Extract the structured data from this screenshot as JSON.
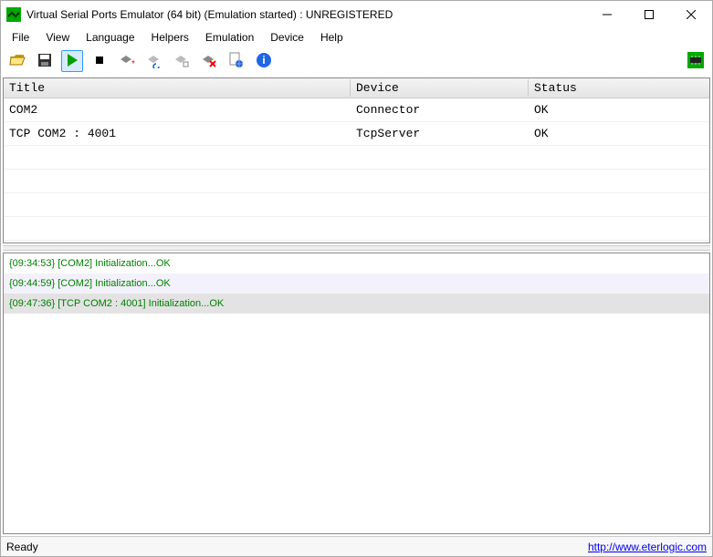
{
  "window": {
    "title": "Virtual Serial Ports Emulator (64 bit) (Emulation started) : UNREGISTERED"
  },
  "menu": {
    "items": [
      "File",
      "View",
      "Language",
      "Helpers",
      "Emulation",
      "Device",
      "Help"
    ]
  },
  "table": {
    "headers": {
      "title": "Title",
      "device": "Device",
      "status": "Status"
    },
    "rows": [
      {
        "title": "COM2",
        "device": "Connector",
        "status": "OK"
      },
      {
        "title": "TCP COM2 : 4001",
        "device": "TcpServer",
        "status": "OK"
      }
    ]
  },
  "log": {
    "entries": [
      "{09:34:53} [COM2] Initialization...OK",
      "{09:44:59} [COM2] Initialization...OK",
      "{09:47:36} [TCP COM2 : 4001] Initialization...OK"
    ]
  },
  "status": {
    "text": "Ready",
    "link": "http://www.eterlogic.com"
  }
}
